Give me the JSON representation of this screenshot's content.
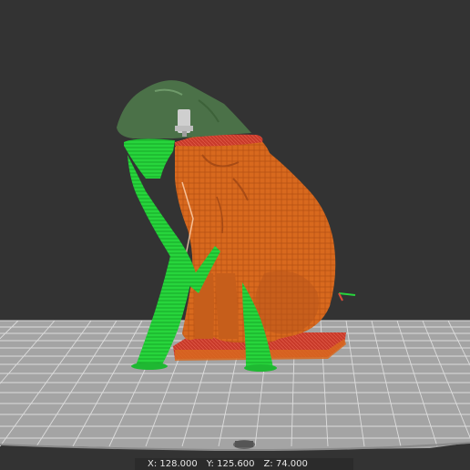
{
  "app": {
    "background": "#333333",
    "bed_color": "#a4a4a4",
    "grid_line_color": "#dcdcdc",
    "model_color": "#d8691e",
    "support_color": "#23d33a",
    "ghost_color": "#4f7a4b",
    "nozzle_color": "#cfcfcf"
  },
  "status": {
    "x_label": "X: 128.000",
    "y_label": "Y: 125.600",
    "z_label": "Z: 74.000"
  }
}
